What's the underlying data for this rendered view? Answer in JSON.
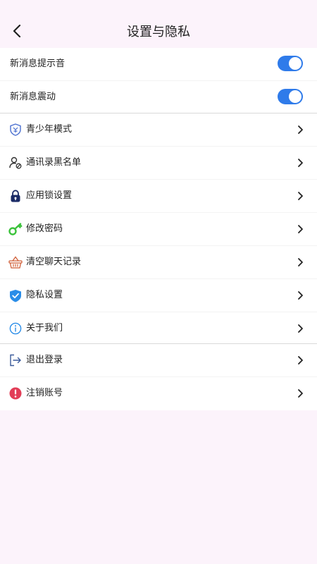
{
  "header": {
    "title": "设置与隐私"
  },
  "notifications": [
    {
      "label": "新消息提示音",
      "enabled": true
    },
    {
      "label": "新消息震动",
      "enabled": true
    }
  ],
  "menu": [
    {
      "label": "青少年模式",
      "icon": "shield-youth-icon"
    },
    {
      "label": "通讯录黑名单",
      "icon": "user-block-icon"
    },
    {
      "label": "应用锁设置",
      "icon": "lock-icon"
    },
    {
      "label": "修改密码",
      "icon": "key-icon"
    },
    {
      "label": "清空聊天记录",
      "icon": "basket-icon"
    },
    {
      "label": "隐私设置",
      "icon": "shield-check-icon"
    },
    {
      "label": "关于我们",
      "icon": "info-icon"
    }
  ],
  "account": [
    {
      "label": "退出登录",
      "icon": "logout-icon"
    },
    {
      "label": "注销账号",
      "icon": "alert-icon"
    }
  ],
  "colors": {
    "background": "#fcf3fb",
    "toggle_on": "#2f7bea",
    "alert": "#e23d57",
    "key": "#3cc33c",
    "lock": "#1a2a66"
  }
}
